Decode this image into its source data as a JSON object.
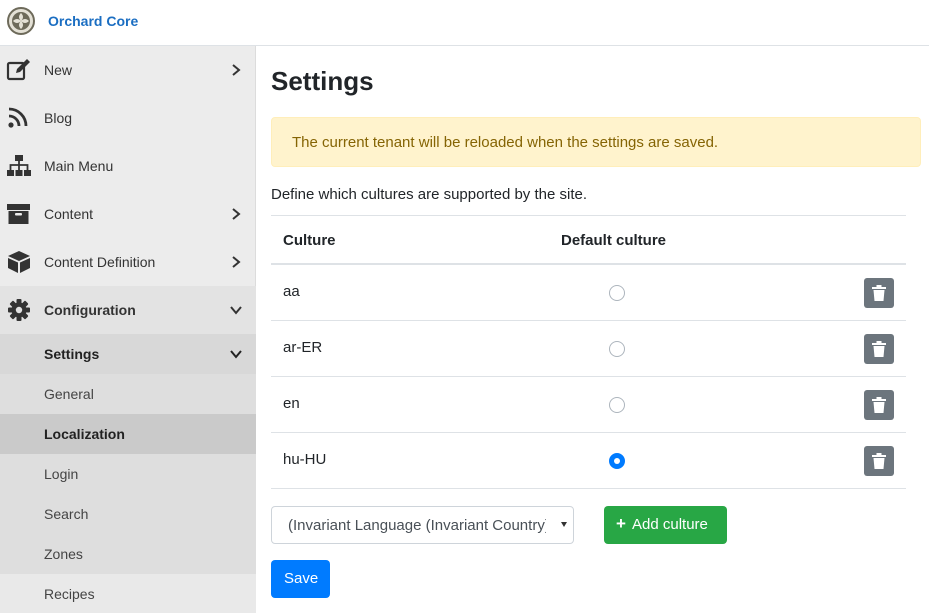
{
  "app": {
    "title": "Orchard Core",
    "logo_icon": "orchard-logo-icon"
  },
  "sidebar": {
    "items": [
      {
        "label": "New",
        "icon": "new-edit-icon",
        "chevron": "right"
      },
      {
        "label": "Blog",
        "icon": "rss-icon",
        "chevron": ""
      },
      {
        "label": "Main Menu",
        "icon": "sitemap-icon",
        "chevron": ""
      },
      {
        "label": "Content",
        "icon": "archive-icon",
        "chevron": "right"
      },
      {
        "label": "Content Definition",
        "icon": "cube-icon",
        "chevron": "right"
      },
      {
        "label": "Configuration",
        "icon": "gear-icon",
        "chevron": "down"
      }
    ],
    "subitems": [
      {
        "label": "Settings",
        "chevron": "down"
      },
      {
        "label": "General"
      },
      {
        "label": "Localization",
        "active": true
      },
      {
        "label": "Login"
      },
      {
        "label": "Search"
      },
      {
        "label": "Zones"
      },
      {
        "label": "Recipes"
      }
    ]
  },
  "main": {
    "title": "Settings",
    "alert": "The current tenant will be reloaded when the settings are saved.",
    "intro": "Define which cultures are supported by the site.",
    "table": {
      "headers": [
        "Culture",
        "Default culture"
      ],
      "rows": [
        {
          "culture": "aa",
          "default": false
        },
        {
          "culture": "ar-ER",
          "default": false
        },
        {
          "culture": "en",
          "default": false
        },
        {
          "culture": "hu-HU",
          "default": true
        }
      ]
    },
    "culture_select": {
      "value": "(Invariant Language (Invariant Country))"
    },
    "add_culture_label": "Add culture",
    "save_label": "Save"
  },
  "colors": {
    "brand": "#1b6ec2",
    "alert_bg": "#fff3cd",
    "alert_text": "#856404",
    "primary": "#007bff",
    "success": "#28a745",
    "secondary": "#6c757d"
  }
}
